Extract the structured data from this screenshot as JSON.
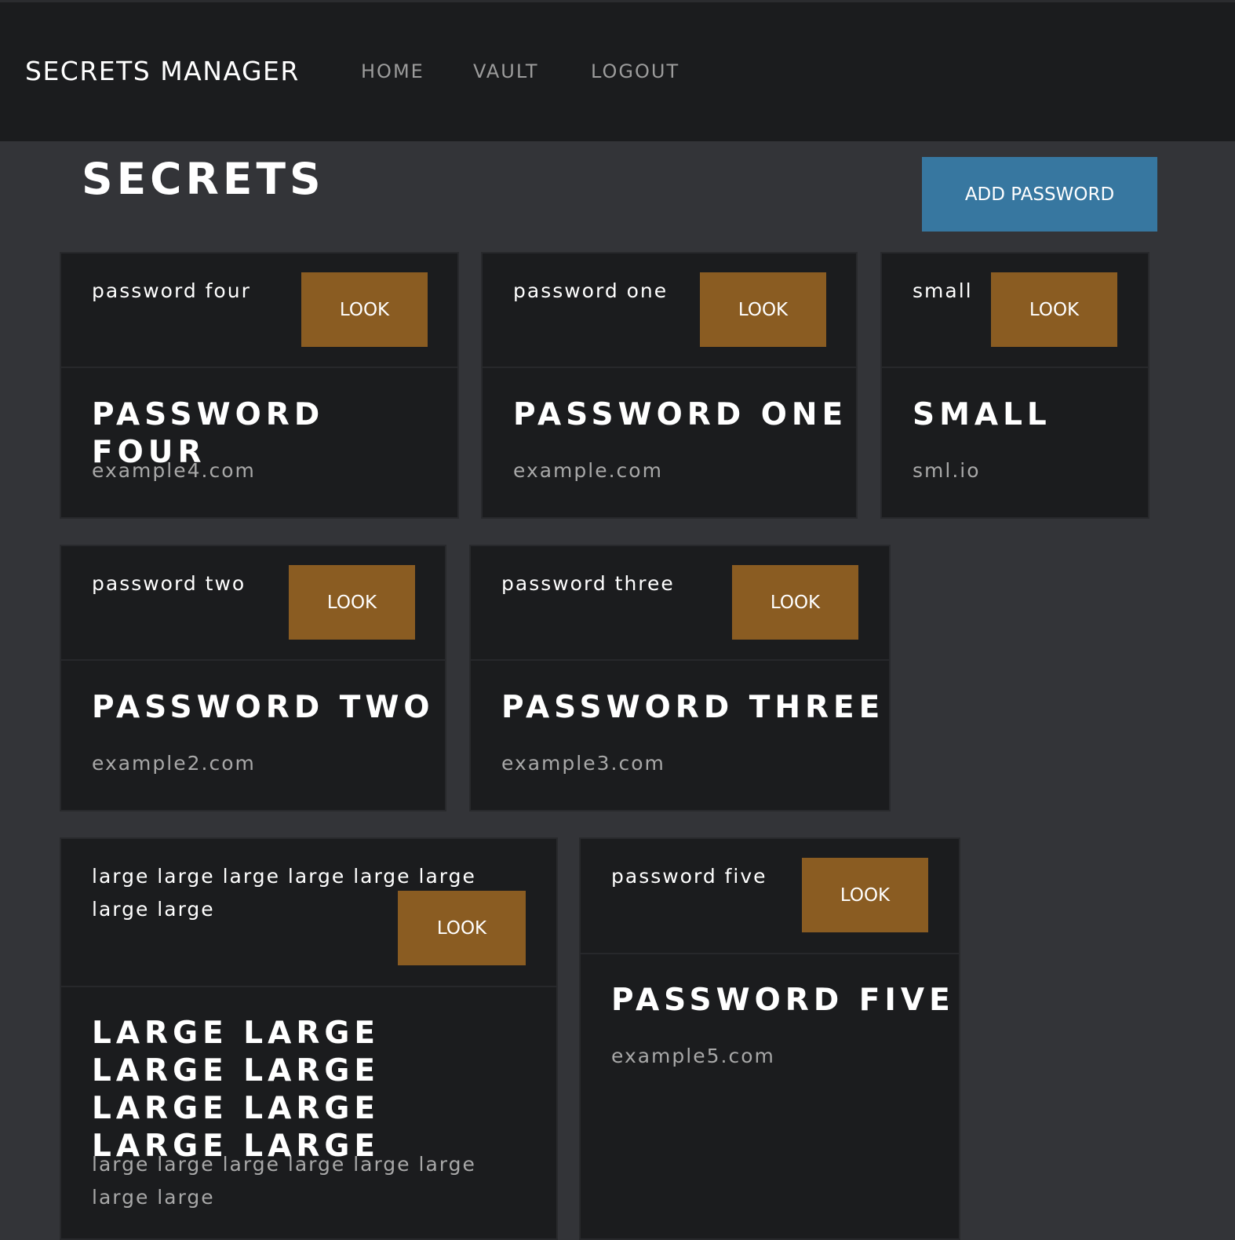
{
  "navbar": {
    "brand": "SECRETS MANAGER",
    "links": [
      "HOME",
      "VAULT",
      "LOGOUT"
    ]
  },
  "page": {
    "title": "SECRETS",
    "add_button": "ADD PASSWORD"
  },
  "colors": {
    "navbar_bg": "#1b1c1e",
    "page_bg": "#333438",
    "card_bg": "#1b1c1e",
    "add_button": "#3777a0",
    "look_button": "#8a5c22"
  },
  "cards": [
    {
      "name": "password four",
      "button": "LOOK",
      "title": "PASSWORD FOUR",
      "url": "example4.com"
    },
    {
      "name": "password one",
      "button": "LOOK",
      "title": "PASSWORD ONE",
      "url": "example.com"
    },
    {
      "name": "small",
      "button": "LOOK",
      "title": "SMALL",
      "url": "sml.io"
    },
    {
      "name": "password two",
      "button": "LOOK",
      "title": "PASSWORD TWO",
      "url": "example2.com"
    },
    {
      "name": "password three",
      "button": "LOOK",
      "title": "PASSWORD THREE",
      "url": "example3.com"
    },
    {
      "name": "large large large large large large large large",
      "button": "LOOK",
      "title": "LARGE LARGE LARGE LARGE LARGE LARGE LARGE LARGE",
      "url": "large large large large large large large large"
    },
    {
      "name": "password five",
      "button": "LOOK",
      "title": "PASSWORD FIVE",
      "url": "example5.com"
    }
  ]
}
